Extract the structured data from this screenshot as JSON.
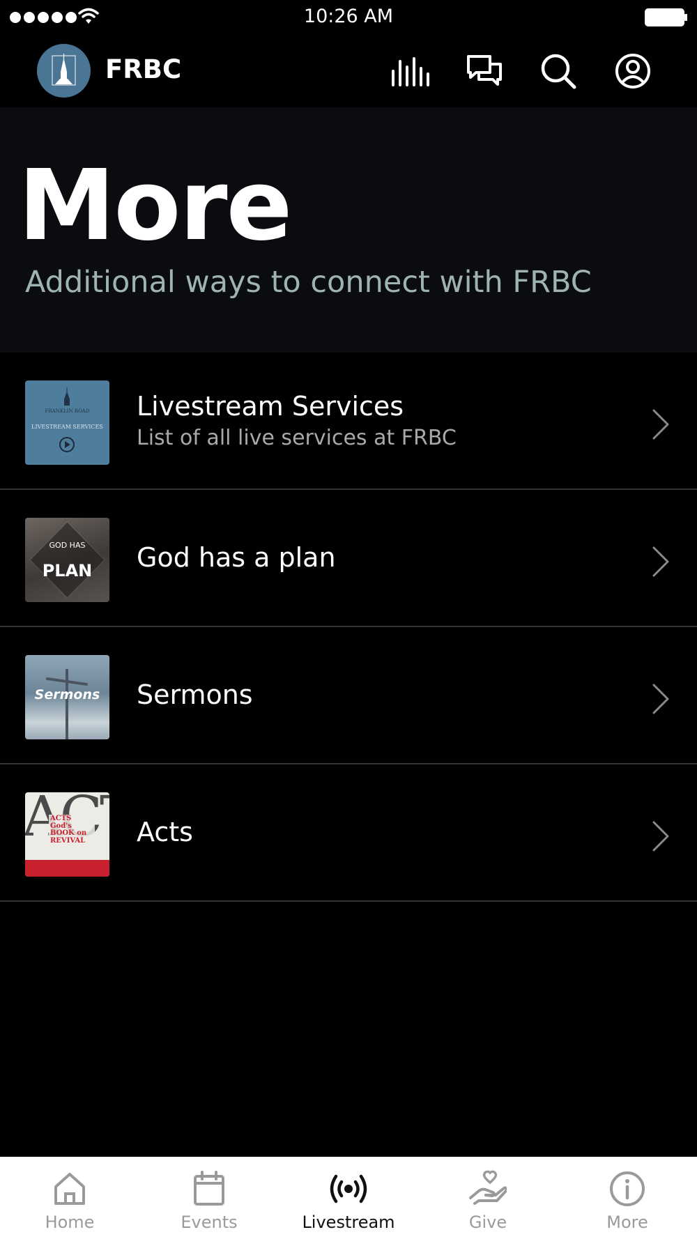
{
  "status_bar": {
    "time": "10:26 AM"
  },
  "header": {
    "brand": "FRBC",
    "icons": [
      "audio-bars-icon",
      "chat-icon",
      "search-icon",
      "profile-icon"
    ]
  },
  "hero": {
    "title": "More",
    "subtitle": "Additional ways to connect with FRBC"
  },
  "list": {
    "items": [
      {
        "title": "Livestream Services",
        "subtitle": "List of all live services at FRBC",
        "thumb": {
          "line1": "FRANKLIN ROAD",
          "line2": "LIVESTREAM SERVICES"
        }
      },
      {
        "title": "God has a plan",
        "thumb": {
          "line1": "GOD HAS",
          "line2": "PLAN"
        }
      },
      {
        "title": "Sermons",
        "thumb": {
          "line1": "Sermons"
        }
      },
      {
        "title": "Acts",
        "thumb": {
          "big": "ACT",
          "line1": "ACTS God's BOOK on REVIVAL"
        }
      }
    ]
  },
  "tab_bar": {
    "active": "Livestream",
    "tabs": [
      {
        "label": "Home",
        "icon": "home-icon"
      },
      {
        "label": "Events",
        "icon": "calendar-icon"
      },
      {
        "label": "Livestream",
        "icon": "broadcast-icon"
      },
      {
        "label": "Give",
        "icon": "give-heart-hand-icon"
      },
      {
        "label": "More",
        "icon": "info-icon"
      }
    ]
  },
  "colors": {
    "background": "#000000",
    "hero_background": "#0b0c0f",
    "subtitle": "#9fb3b4",
    "logo_blue": "#4a7595",
    "tab_active": "#111111",
    "tab_inactive": "#9a9a9a"
  }
}
